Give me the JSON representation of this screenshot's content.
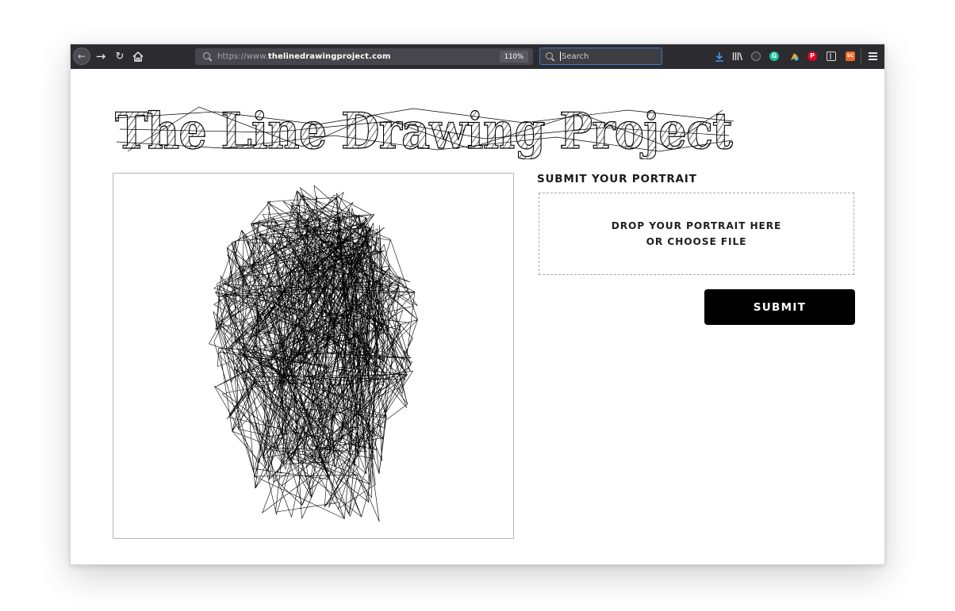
{
  "browser": {
    "url_prefix": "https://www.",
    "url_host": "thelinedrawingproject.com",
    "zoom": "110%",
    "search_placeholder": "Search",
    "icons": {
      "back": "back-arrow-icon",
      "forward": "forward-arrow-icon",
      "reload": "reload-icon",
      "home": "home-icon",
      "search": "search-icon",
      "download": "download-icon",
      "library": "library-icon",
      "menu": "hamburger-menu-icon"
    },
    "extensions": [
      {
        "name": "dark-circle-extension-icon",
        "color": "#3a3a3a"
      },
      {
        "name": "grammarly-icon",
        "glyph": "G",
        "color": "#15c39a"
      },
      {
        "name": "honey-extension-icon",
        "color": "#f5a623"
      },
      {
        "name": "pinterest-icon",
        "glyph": "P",
        "color": "#e60023"
      },
      {
        "name": "sidebar-icon",
        "color": "#5e5e64"
      },
      {
        "name": "sc-extension-icon",
        "glyph": "SC",
        "color": "#f26522"
      }
    ]
  },
  "page": {
    "logo_text": "The Line Drawing Project",
    "form": {
      "heading": "SUBMIT YOUR PORTRAIT",
      "dropzone_line1": "DROP YOUR PORTRAIT HERE",
      "dropzone_line2": "OR CHOOSE FILE",
      "submit_label": "SUBMIT"
    },
    "colors": {
      "accent": "#000000",
      "search_focus": "#3c78c8",
      "download": "#3d9af5"
    }
  }
}
